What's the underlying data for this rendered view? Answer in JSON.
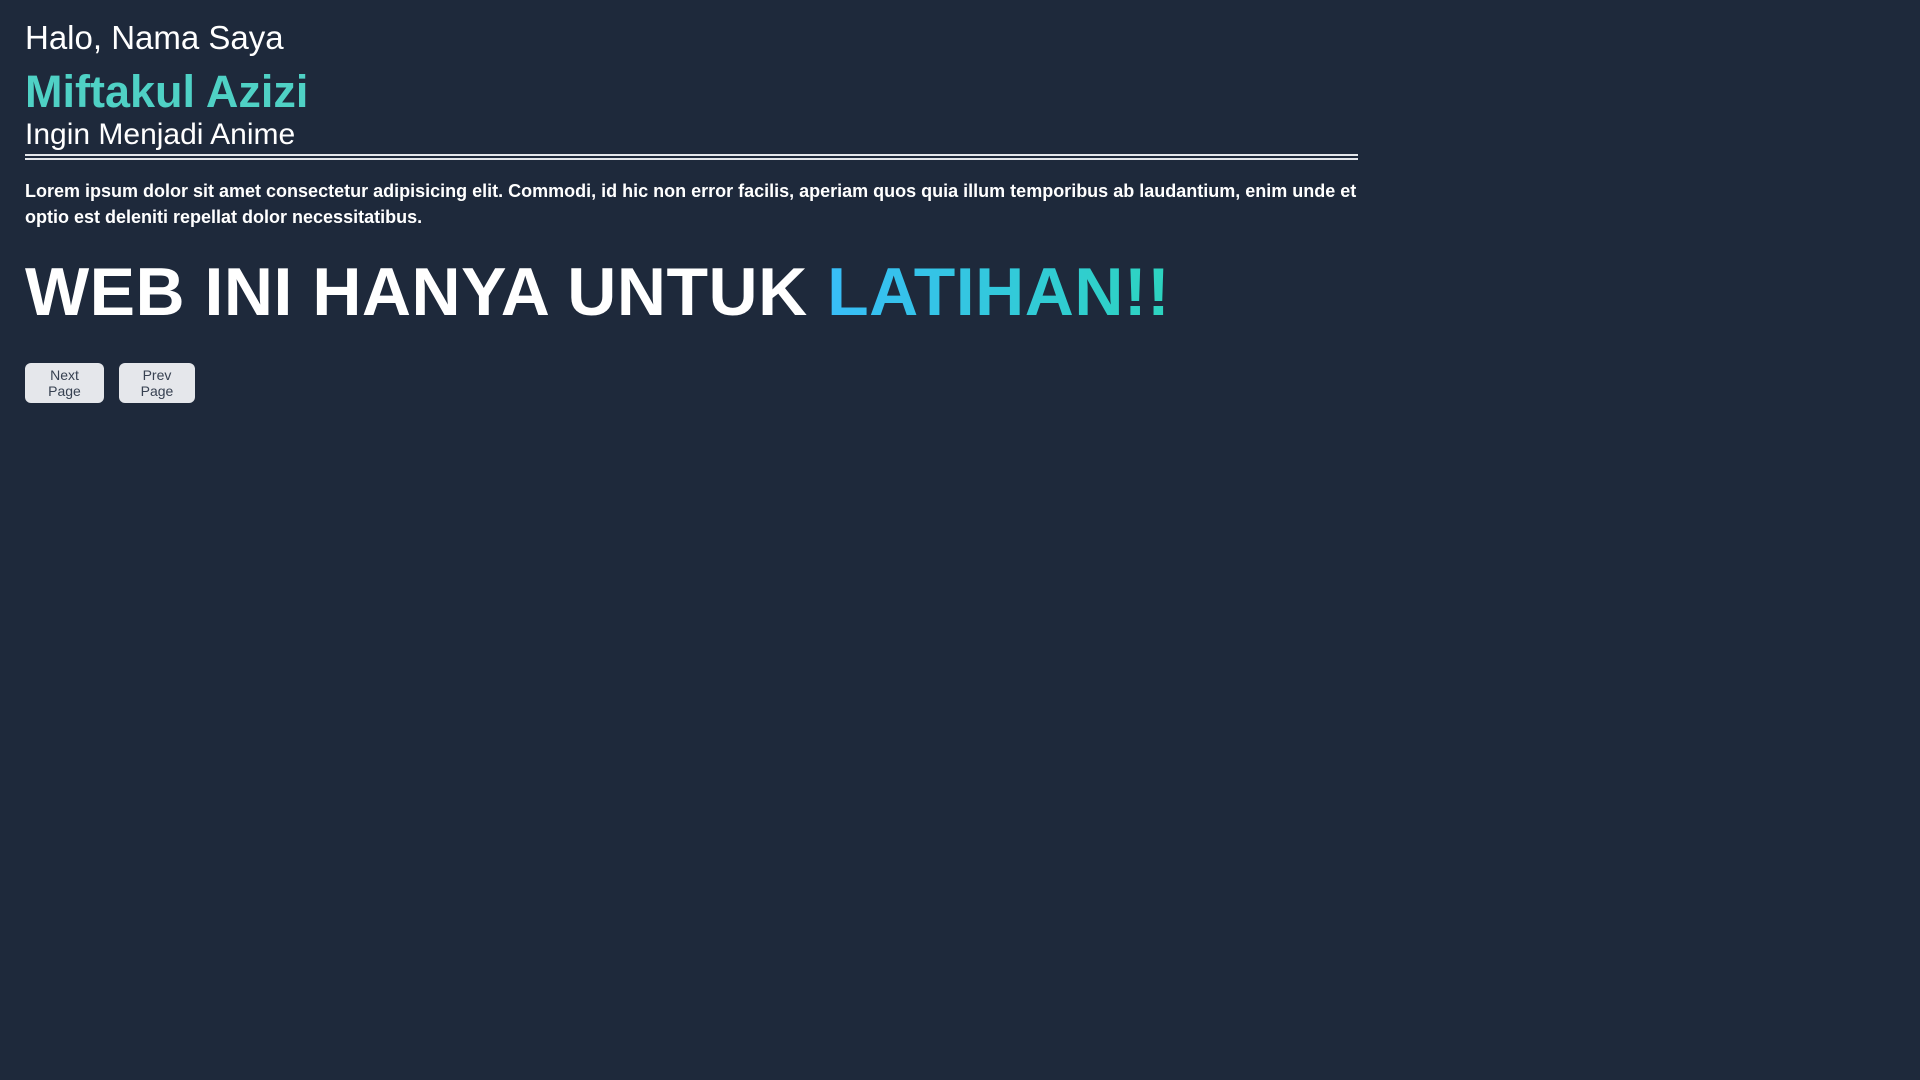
{
  "hero": {
    "greeting": "Halo, Nama Saya",
    "name": "Miftakul Azizi",
    "subtitle": "Ingin Menjadi Anime"
  },
  "content": {
    "paragraph": "Lorem ipsum dolor sit amet consectetur adipisicing elit. Commodi, id hic non error facilis, aperiam quos quia illum temporibus ab laudantium, enim unde et optio est deleniti repellat dolor necessitatibus.",
    "headline_main": "WEB INI HANYA UNTUK ",
    "headline_accent": "LATIHAN!!"
  },
  "buttons": {
    "next_label": "Next Page",
    "prev_label": "Prev Page"
  },
  "colors": {
    "background": "#1e293b",
    "name_accent": "#4fd1c5",
    "headline_gradient_start": "#38bdf8",
    "headline_gradient_end": "#2dd4bf",
    "button_bg": "#e5e7eb"
  }
}
